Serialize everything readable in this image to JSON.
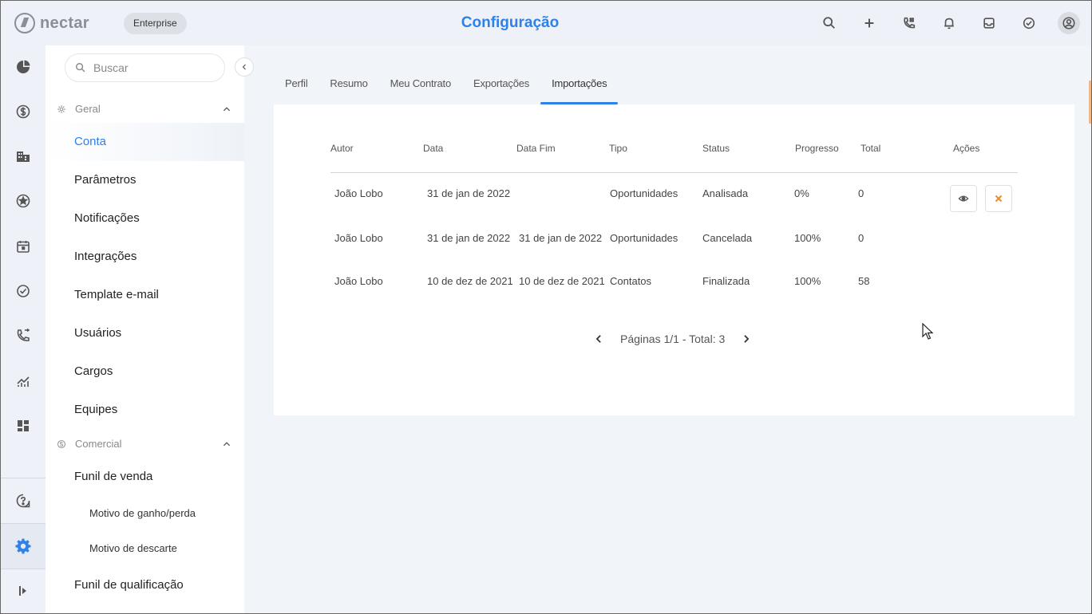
{
  "app": {
    "logo_text": "nectar",
    "badge": "Enterprise",
    "page_title": "Configuração"
  },
  "top_icons": [
    "search-icon",
    "plus-icon",
    "phone-icon",
    "bell-icon",
    "inbox-icon",
    "check-circle-icon",
    "user-avatar-icon"
  ],
  "rail_icons": [
    "dashboard-icon",
    "dollar-icon",
    "building-icon",
    "star-icon",
    "calendar-icon",
    "check-icon",
    "call-icon",
    "chart-icon",
    "widgets-icon",
    "help-icon",
    "settings-icon",
    "expand-icon"
  ],
  "sidebar": {
    "search_placeholder": "Buscar",
    "sections": [
      {
        "label": "Geral",
        "items": [
          "Conta",
          "Parâmetros",
          "Notificações",
          "Integrações",
          "Template e-mail",
          "Usuários",
          "Cargos",
          "Equipes"
        ]
      },
      {
        "label": "Comercial",
        "items": [
          "Funil de venda",
          "Motivo de ganho/perda",
          "Motivo de descarte",
          "Funil de qualificação"
        ]
      }
    ],
    "active_item": "Conta"
  },
  "tabs": [
    "Perfil",
    "Resumo",
    "Meu Contrato",
    "Exportações",
    "Importações"
  ],
  "active_tab": "Importações",
  "table": {
    "headers": [
      "Autor",
      "Data",
      "Data Fim",
      "Tipo",
      "Status",
      "Progresso",
      "Total",
      "Ações"
    ],
    "rows": [
      {
        "autor": "João Lobo",
        "data": "31 de jan de 2022",
        "data_fim": "",
        "tipo": "Oportunidades",
        "status": "Analisada",
        "progresso": "0%",
        "total": "0",
        "has_actions": true
      },
      {
        "autor": "João Lobo",
        "data": "31 de jan de 2022",
        "data_fim": "31 de jan de 2022",
        "tipo": "Oportunidades",
        "status": "Cancelada",
        "progresso": "100%",
        "total": "0",
        "has_actions": false
      },
      {
        "autor": "João Lobo",
        "data": "10 de dez de 2021",
        "data_fim": "10 de dez de 2021",
        "tipo": "Contatos",
        "status": "Finalizada",
        "progresso": "100%",
        "total": "58",
        "has_actions": false
      }
    ]
  },
  "pagination": {
    "text": "Páginas 1/1 - Total: 3"
  },
  "colors": {
    "accent": "#2f80e7",
    "cancel_icon": "#e8912c",
    "background": "#f1f4f9"
  }
}
